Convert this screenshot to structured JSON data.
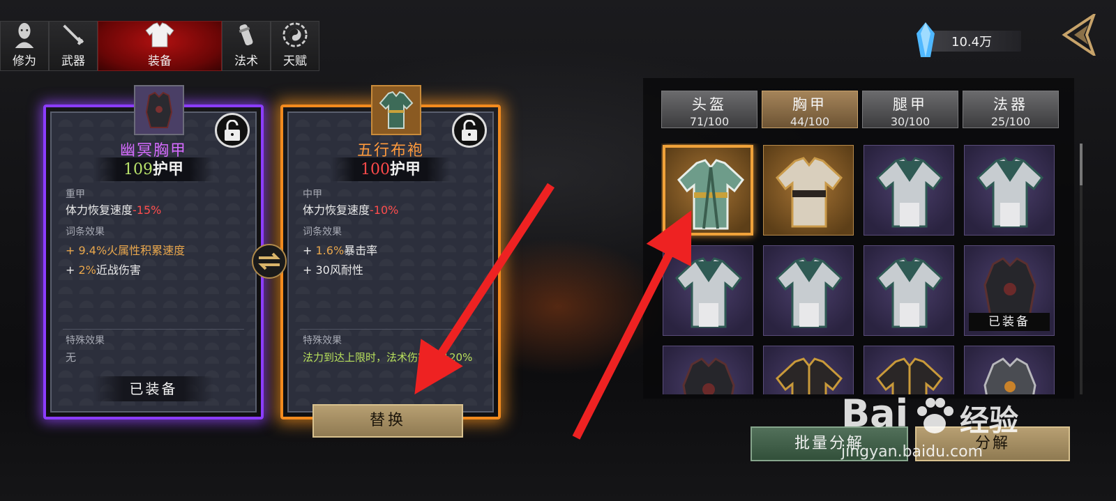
{
  "top_tabs": [
    {
      "label": "修为",
      "icon": "cultivation-icon"
    },
    {
      "label": "武器",
      "icon": "weapon-icon"
    },
    {
      "label": "装备",
      "icon": "armor-icon",
      "active": true
    },
    {
      "label": "法术",
      "icon": "spell-icon"
    },
    {
      "label": "天赋",
      "icon": "talent-icon"
    }
  ],
  "currency": {
    "amount": "10.4万",
    "icon": "crystal-gem-icon"
  },
  "equipped_item": {
    "name": "幽冥胸甲",
    "armor_value": "109",
    "armor_unit": "护甲",
    "type": "重甲",
    "stamina_label": "体力恢复速度",
    "stamina_value": "-15%",
    "affix_title": "词条效果",
    "affix_1_prefix": "+ ",
    "affix_1_value": "9.4%",
    "affix_1_text": "火属性积累速度",
    "affix_2_prefix": "+ ",
    "affix_2_value": "2%",
    "affix_2_text": "近战伤害",
    "special_title": "特殊效果",
    "special_text": "无",
    "status": "已装备",
    "rarity_color": "#8b3cff"
  },
  "compare_item": {
    "name": "五行布袍",
    "armor_value": "100",
    "armor_unit": "护甲",
    "type": "中甲",
    "stamina_label": "体力恢复速度",
    "stamina_value": "-10%",
    "affix_title": "词条效果",
    "affix_1_prefix": "+ ",
    "affix_1_value": "1.6%",
    "affix_1_text": "暴击率",
    "affix_2_text": "+ 30风耐性",
    "special_title": "特殊效果",
    "special_text": "法力到达上限时，法术伤害提升20%",
    "action": "替换",
    "rarity_color": "#f28a1e"
  },
  "categories": [
    {
      "name": "头盔",
      "count": "71/100"
    },
    {
      "name": "胸甲",
      "count": "44/100",
      "active": true
    },
    {
      "name": "腿甲",
      "count": "30/100"
    },
    {
      "name": "法器",
      "count": "25/100"
    }
  ],
  "inventory": {
    "equipped_tag": "已装备",
    "items": [
      {
        "rarity": "gold",
        "style": "robe-green",
        "selected": true
      },
      {
        "rarity": "gold",
        "style": "robe-white"
      },
      {
        "rarity": "purple",
        "style": "robe-teal"
      },
      {
        "rarity": "purple",
        "style": "robe-teal"
      },
      {
        "rarity": "purple",
        "style": "robe-teal"
      },
      {
        "rarity": "purple",
        "style": "robe-teal"
      },
      {
        "rarity": "purple",
        "style": "robe-teal"
      },
      {
        "rarity": "purple",
        "style": "armor-dark",
        "equipped": true
      },
      {
        "rarity": "purple",
        "style": "armor-dark"
      },
      {
        "rarity": "purple",
        "style": "robe-black-gold"
      },
      {
        "rarity": "purple",
        "style": "robe-black-gold"
      },
      {
        "rarity": "purple",
        "style": "armor-steel"
      }
    ]
  },
  "buttons": {
    "bulk_decompose": "批量分解",
    "decompose": "分解"
  },
  "watermark": {
    "brand": "Bai",
    "brand2": "经验",
    "url": "jingyan.baidu.com"
  },
  "colors": {
    "arrow": "#ee2222",
    "selected_border": "#f0a23a",
    "active_tab": "#b01010"
  }
}
